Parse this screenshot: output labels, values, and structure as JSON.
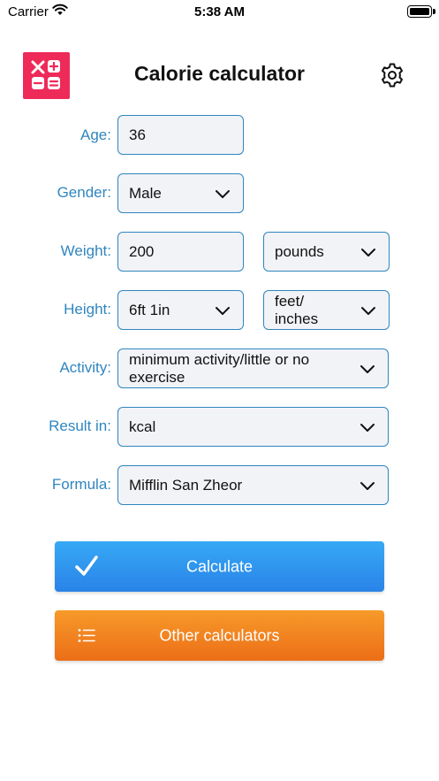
{
  "status_bar": {
    "carrier": "Carrier",
    "time": "5:38 AM"
  },
  "header": {
    "title": "Calorie calculator",
    "logo_icon": "calculator-icon",
    "settings_icon": "gear-icon"
  },
  "form": {
    "age": {
      "label": "Age:",
      "value": "36"
    },
    "gender": {
      "label": "Gender:",
      "value": "Male"
    },
    "weight": {
      "label": "Weight:",
      "value": "200",
      "unit": "pounds"
    },
    "height": {
      "label": "Height:",
      "value": "6ft 1in",
      "unit": "feet/ inches"
    },
    "activity": {
      "label": "Activity:",
      "value": "minimum activity/little or no exercise"
    },
    "result_in": {
      "label": "Result in:",
      "value": "kcal"
    },
    "formula": {
      "label": "Formula:",
      "value": "Mifflin San Zheor"
    }
  },
  "buttons": {
    "calculate": {
      "label": "Calculate",
      "icon": "checkmark-icon"
    },
    "other": {
      "label": "Other calculators",
      "icon": "list-icon"
    }
  },
  "colors": {
    "accent": "#2f86bf",
    "logo": "#ee2a59",
    "calculate": "#2a83e8",
    "other": "#ec6e17"
  }
}
